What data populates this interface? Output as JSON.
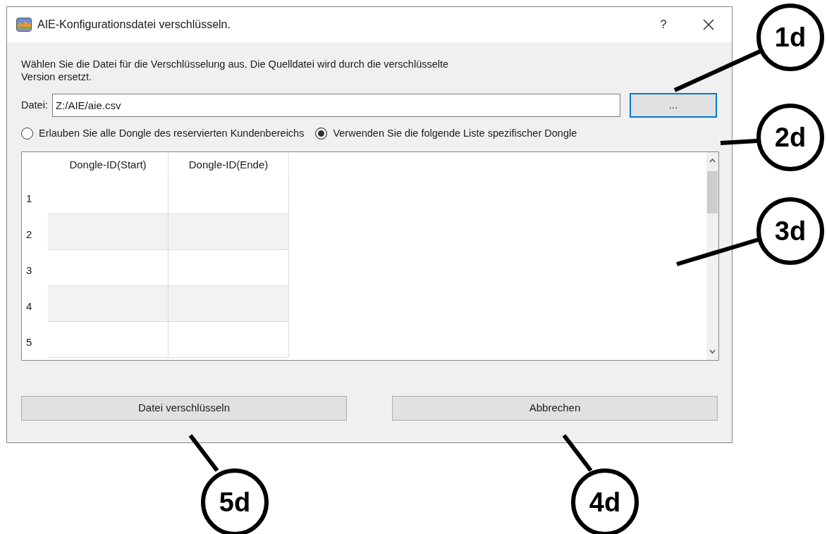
{
  "window": {
    "title": "AIE-Konfigurationsdatei verschlüsseln.",
    "help": "?"
  },
  "instructions": "Wählen Sie die Datei für die Verschlüsselung aus. Die Quelldatei wird durch die verschlüsselte Version ersetzt.",
  "file": {
    "label": "Datei:",
    "value": "Z:/AIE/aie.csv",
    "browse": "..."
  },
  "options": [
    {
      "label": "Erlauben Sie alle Dongle des reservierten Kundenbereichs",
      "selected": false
    },
    {
      "label": "Verwenden Sie die folgende Liste spezifischer Dongle",
      "selected": true
    }
  ],
  "table": {
    "columns": [
      "Dongle-ID(Start)",
      "Dongle-ID(Ende)"
    ],
    "rows": [
      "1",
      "2",
      "3",
      "4",
      "5"
    ]
  },
  "buttons": [
    "Datei verschlüsseln",
    "Abbrechen"
  ],
  "callouts": [
    "1d",
    "2d",
    "3d",
    "4d",
    "5d"
  ]
}
